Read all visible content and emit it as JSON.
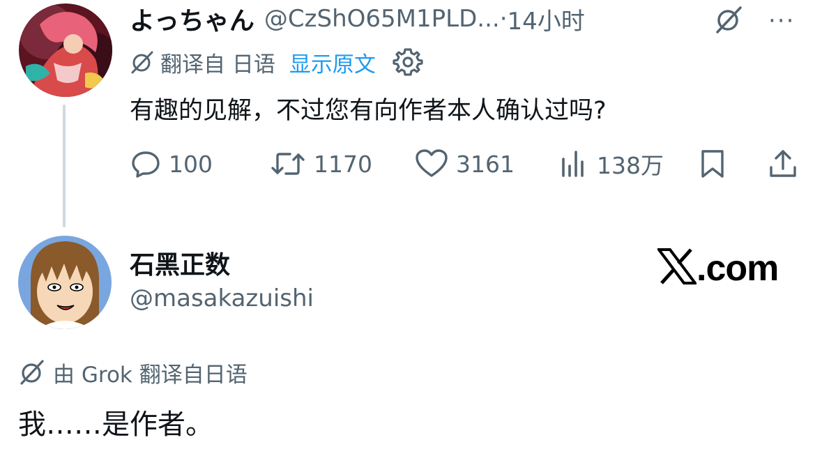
{
  "tweet1": {
    "author_name": "よっちゃん",
    "handle": "@CzShO65M1PLD...",
    "time_sep": "·",
    "time": "14小时",
    "more_icon": "more-dots-icon",
    "grok_icon": "grok-icon",
    "translation": {
      "label": "翻译自 日语",
      "show_original": "显示原文",
      "settings_icon": "gear-icon"
    },
    "text": "有趣的见解，不过您有向作者本人确认过吗?",
    "actions": {
      "replies": "100",
      "retweets": "1170",
      "likes": "3161",
      "views": "138万"
    }
  },
  "tweet2": {
    "author_name": "石黑正数",
    "handle": "@masakazuishi",
    "watermark_text": ".com",
    "translation": {
      "label": "由 Grok 翻译自日语"
    },
    "text": "我……是作者。"
  },
  "colors": {
    "text": "#0f1419",
    "secondary": "#536471",
    "link": "#1d9bf0",
    "thread_line": "#cfd9de"
  }
}
